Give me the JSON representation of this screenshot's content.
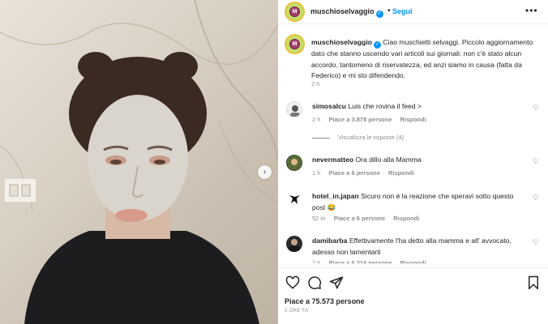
{
  "post": {
    "username": "muschioselvaggio",
    "follow_label": "Segui",
    "dot": "•",
    "avatar_letter": "M",
    "caption_username": "muschioselvaggio",
    "caption_text": "Ciao muschietti selvaggi. Piccolo aggiornamento dato che stanno uscendo vari articoli sui giornali: non c'è stato alcun accordo, tantomeno di riservatezza, ed anzi siamo in causa (fatta da Federico) e mi sto difendendo.",
    "caption_time": "2 h",
    "likes": "Piace a 75.573 persone",
    "date": "2 ORE FA"
  },
  "comments": [
    {
      "username": "simosalcu",
      "text": "Luis che rovina il feed >",
      "time": "2 h",
      "likes": "Piace a 3.878 persone",
      "reply": "Rispondi"
    },
    {
      "username": "nevermatteo",
      "text": "Ora dillo alla Mamma",
      "time": "1 h",
      "likes": "Piace a 6 persone",
      "reply": "Rispondi"
    },
    {
      "username": "hotel_in.japan",
      "text": "Sicuro non è la reazione che speravi sotto questo post 😂",
      "time": "52 m",
      "likes": "Piace a 6 persone",
      "reply": "Rispondi"
    },
    {
      "username": "damibarba",
      "text": "Effettivamente l'ha detto alla mamma e all' avvocato, adesso non lamentarti",
      "time": "2 h",
      "likes": "Piace a 6.216 persone",
      "reply": "Rispondi"
    }
  ],
  "view_replies": "Visualizza le risposte (4)",
  "icons": {
    "verified": "verified-badge-icon",
    "more": "more-options-icon",
    "heart": "heart-icon",
    "comment": "comment-icon",
    "share": "share-icon",
    "save": "bookmark-icon",
    "next": "chevron-right-icon"
  },
  "colors": {
    "accent": "#0095f6",
    "muted": "#8e8e8e",
    "text": "#262626"
  }
}
